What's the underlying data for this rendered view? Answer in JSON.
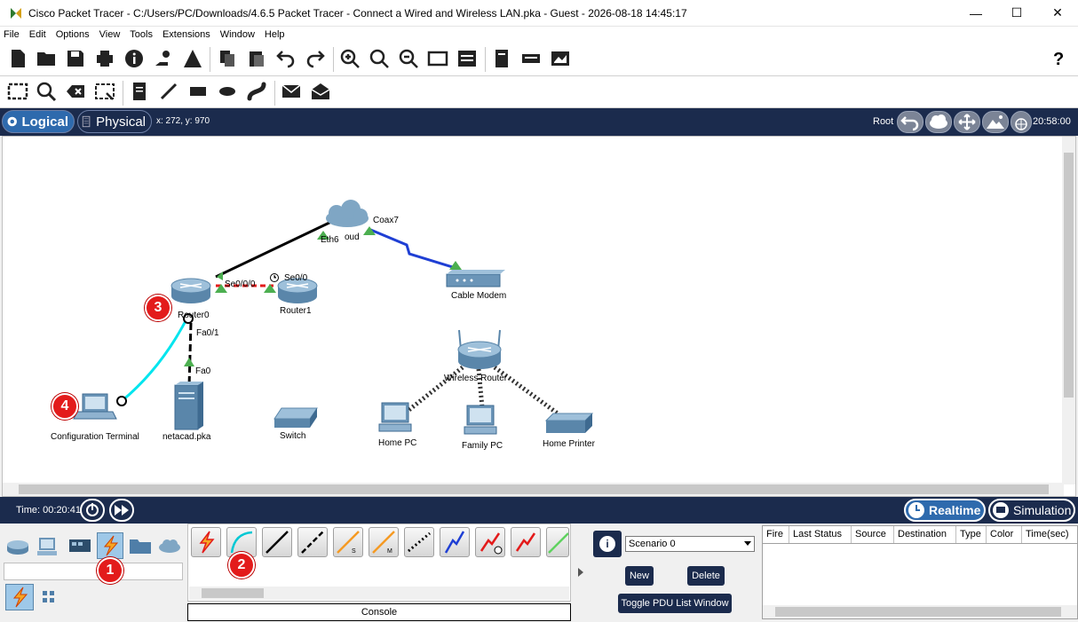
{
  "window": {
    "title": "Cisco Packet Tracer - C:/Users/PC/Downloads/4.6.5 Packet Tracer - Connect a Wired and Wireless LAN.pka - Guest - 2026-08-18 14:45:17",
    "minimize": "—",
    "maximize": "☐",
    "close": "✕"
  },
  "menu": [
    "File",
    "Edit",
    "Options",
    "View",
    "Tools",
    "Extensions",
    "Window",
    "Help"
  ],
  "help_glyph": "?",
  "modebar": {
    "logical": "Logical",
    "physical": "Physical",
    "coords": "x: 272, y: 970",
    "root": "Root",
    "clock": "20:58:00"
  },
  "devices": {
    "cloud": "oud",
    "cable_modem": "Cable Modem",
    "router0": "Router0",
    "router1": "Router1",
    "wireless_router": "Wireless Router",
    "config_terminal": "Configuration Terminal",
    "server": "netacad.pka",
    "switch": "Switch",
    "home_pc": "Home PC",
    "family_pc": "Family PC",
    "home_printer": "Home Printer"
  },
  "ports": {
    "coax7": "Coax7",
    "eth6": "Eth6",
    "se000": "Se0/0/0",
    "se00": "Se0/0",
    "fa01": "Fa0/1",
    "fa0": "Fa0"
  },
  "timebar": {
    "time": "Time: 00:20:41",
    "realtime": "Realtime",
    "simulation": "Simulation"
  },
  "connection_labels": {
    "s": "S",
    "m": "M"
  },
  "bottom": {
    "console": "Console",
    "scenario": "Scenario 0",
    "info_glyph": "i",
    "new": "New",
    "delete": "Delete",
    "toggle": "Toggle PDU List Window",
    "pdu_columns": [
      "Fire",
      "Last Status",
      "Source",
      "Destination",
      "Type",
      "Color",
      "Time(sec)"
    ]
  },
  "badges": [
    "1",
    "2",
    "3",
    "4"
  ],
  "colors": {
    "navy": "#1b2b4d",
    "accent": "#2e6aad",
    "badge": "#e31b1b",
    "console_cable": "#00e5ee"
  }
}
